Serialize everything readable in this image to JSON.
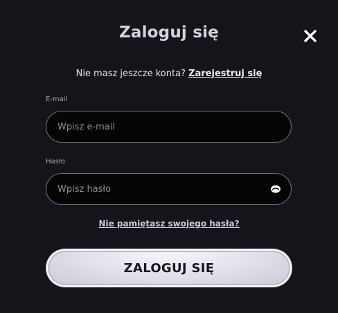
{
  "modal": {
    "title": "Zaloguj się",
    "close_icon": "close-icon"
  },
  "signup": {
    "prompt": "Nie masz jeszcze konta?",
    "link_label": "Zarejestruj się"
  },
  "email": {
    "label": "E-mail",
    "placeholder": "Wpisz e-mail",
    "value": ""
  },
  "password": {
    "label": "Hasło",
    "placeholder": "Wpisz hasło",
    "value": "",
    "toggle_icon": "eye-icon"
  },
  "forgot_password": {
    "label": "Nie pamiętasz swojego hasła?"
  },
  "login_button": {
    "label": "ZALOGUJ SIĘ"
  },
  "colors": {
    "background": "#14151a",
    "input_background": "#050506",
    "input_border": "#6e6f78",
    "button_background": "#e3e3ec",
    "button_text": "#17181f"
  }
}
